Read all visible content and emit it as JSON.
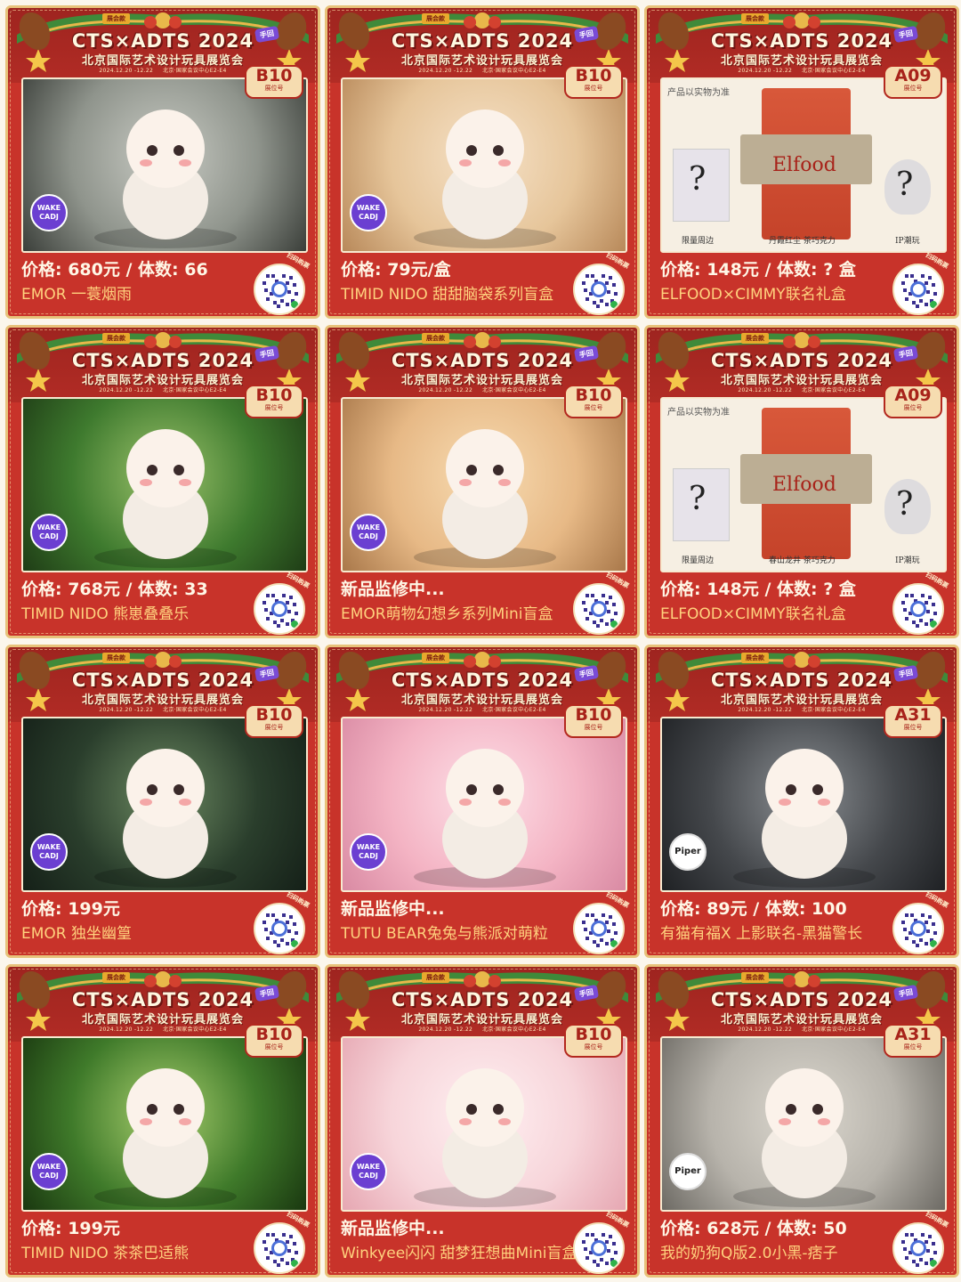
{
  "header": {
    "title": "CTS×ADTS 2024",
    "subtitle": "北京国际艺术设计玩具展览会",
    "dates": "2024.12.20 -12.22",
    "venue": "北京·国家会议中心E2-E4",
    "corner_tag": "展会款",
    "purple_tag": "手回",
    "booth_label": "展位号",
    "scan_label": "扫码购票"
  },
  "brands": {
    "wake": "WAKE CADJ",
    "piper": "Piper"
  },
  "elfood": {
    "note": "产品以实物为准",
    "brand_text": "Elfood",
    "cap_left": "限量周边",
    "cap_right": "IP潮玩",
    "cap_mid_a": "丹霞红尘 茶巧克力",
    "cap_mid_b": "春山龙井 茶巧克力"
  },
  "cards": [
    {
      "booth": "B10",
      "price": "价格: 680元  /  体数: 66",
      "name": "EMOR 一蓑烟雨",
      "logo": "wake"
    },
    {
      "booth": "B10",
      "price": "价格: 79元/盒",
      "name": "TIMID NIDO 甜甜脑袋系列盲盒",
      "logo": "wake"
    },
    {
      "booth": "A09",
      "price": "价格: 148元  /  体数: ? 盒",
      "name": "ELFOOD×CIMMY联名礼盒",
      "logo": "none"
    },
    {
      "booth": "B10",
      "price": "价格: 768元  /  体数: 33",
      "name": "TIMID NIDO 熊崽叠叠乐",
      "logo": "wake"
    },
    {
      "booth": "B10",
      "price": "新品监修中...",
      "name": "EMOR萌物幻想乡系列Mini盲盒",
      "logo": "wake"
    },
    {
      "booth": "A09",
      "price": "价格: 148元  /  体数: ? 盒",
      "name": "ELFOOD×CIMMY联名礼盒",
      "logo": "none"
    },
    {
      "booth": "B10",
      "price": "价格: 199元",
      "name": "EMOR 独坐幽篁",
      "logo": "wake"
    },
    {
      "booth": "B10",
      "price": "新品监修中...",
      "name": "TUTU BEAR兔兔与熊派对萌粒",
      "logo": "wake"
    },
    {
      "booth": "A31",
      "price": "价格: 89元  /  体数: 100",
      "name": "有猫有福X 上影联名-黑猫警长",
      "logo": "piper"
    },
    {
      "booth": "B10",
      "price": "价格: 199元",
      "name": "TIMID NIDO 茶茶巴适熊",
      "logo": "wake"
    },
    {
      "booth": "B10",
      "price": "新品监修中...",
      "name": "Winkyee闪闪 甜梦狂想曲Mini盲盒",
      "logo": "wake"
    },
    {
      "booth": "A31",
      "price": "价格: 628元  /  体数: 50",
      "name": "我的奶狗Q版2.0小黑-痞子",
      "logo": "piper"
    }
  ],
  "colors": {
    "card_red": "#c8332a",
    "gold": "#e7c27a",
    "name_text": "#ffd27e",
    "price_text": "#fff7e6",
    "wake_purple": "#6b3fd1"
  }
}
